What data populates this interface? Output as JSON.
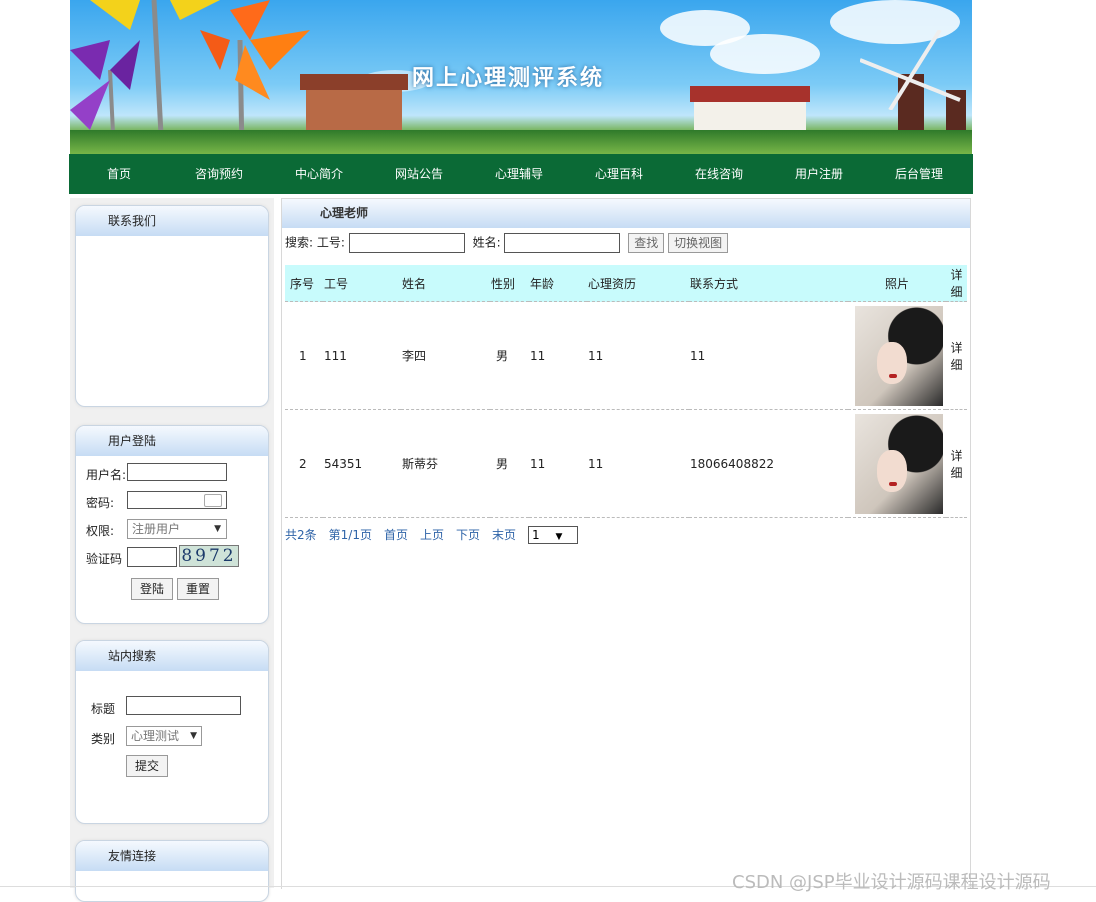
{
  "site": {
    "title": "网上心理测评系统"
  },
  "nav": [
    "首页",
    "咨询预约",
    "中心简介",
    "网站公告",
    "心理辅导",
    "心理百科",
    "在线咨询",
    "用户注册",
    "后台管理"
  ],
  "sidebar": {
    "contact": {
      "title": "联系我们"
    },
    "login": {
      "title": "用户登陆",
      "username_label": "用户名:",
      "password_label": "密码:",
      "role_label": "权限:",
      "role_value": "注册用户",
      "captcha_label": "验证码",
      "captcha_text": "8972",
      "login_button": "登陆",
      "reset_button": "重置"
    },
    "site_search": {
      "title": "站内搜索",
      "title_label": "标题",
      "category_label": "类别",
      "category_value": "心理测试",
      "submit_button": "提交"
    },
    "links": {
      "title": "友情连接"
    }
  },
  "main": {
    "title": "心理老师",
    "search": {
      "prefix": "搜索:",
      "id_label": "工号:",
      "name_label": "姓名:",
      "find_button": "查找",
      "switch_button": "切换视图"
    },
    "columns": [
      "序号",
      "工号",
      "姓名",
      "性别",
      "年龄",
      "心理资历",
      "联系方式",
      "照片",
      "详细"
    ],
    "rows": [
      {
        "index": "1",
        "id": "111",
        "name": "李四",
        "gender": "男",
        "age": "11",
        "qualification": "11",
        "contact": "11",
        "detail": "详细"
      },
      {
        "index": "2",
        "id": "54351",
        "name": "斯蒂芬",
        "gender": "男",
        "age": "11",
        "qualification": "11",
        "contact": "18066408822",
        "detail": "详细"
      }
    ],
    "pager": {
      "total": "共2条",
      "page": "第1/1页",
      "first": "首页",
      "prev": "上页",
      "next": "下页",
      "last": "末页",
      "select_value": "1"
    }
  },
  "watermark": "CSDN @JSP毕业设计源码课程设计源码",
  "colors": {
    "nav_bg": "#0b6a36",
    "header_row_bg": "#c8fbfc",
    "link": "#2f64a8"
  }
}
